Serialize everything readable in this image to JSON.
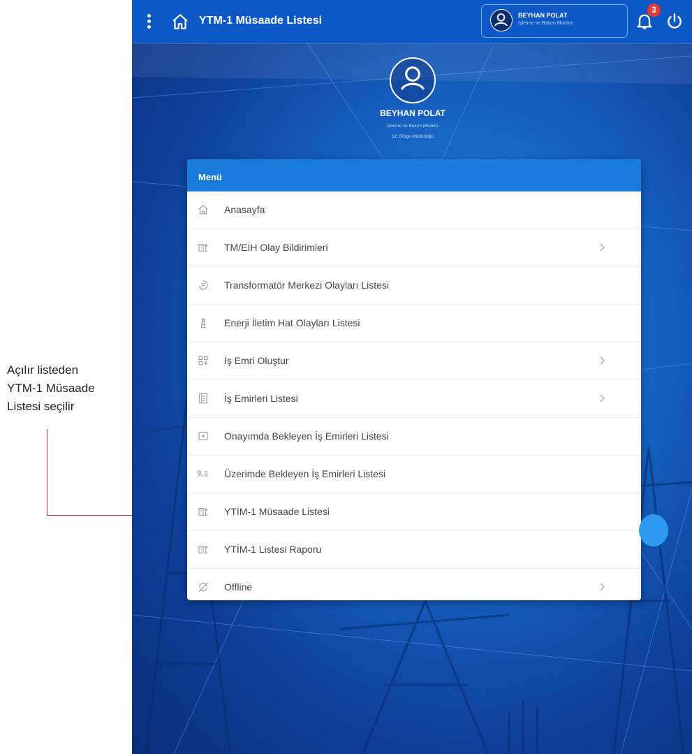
{
  "annotation": {
    "lines": [
      "Açılır listeden",
      "YTM-1 Müsaade",
      "Listesi  seçilir"
    ]
  },
  "header": {
    "title": "YTM-1 Müsaade Listesi",
    "user_name": "BEYHAN POLAT",
    "user_role": "İşletme ve Bakım Müdürü",
    "notification_count": "3"
  },
  "profile": {
    "name": "BEYHAN POLAT",
    "role": "İşletme ve Bakım Müdürü",
    "department": "12. Bölge Müdürlüğü"
  },
  "menu": {
    "title": "Menü",
    "items": [
      {
        "label": "Anasayfa",
        "icon": "home-icon",
        "has_submenu": false
      },
      {
        "label": "TM/EİH Olay Bildirimleri",
        "icon": "report-icon",
        "has_submenu": true
      },
      {
        "label": "Transformatör Merkezi Olayları Listesi",
        "icon": "transformer-icon",
        "has_submenu": false
      },
      {
        "label": "Enerji İletim Hat Olayları Listesi",
        "icon": "tower-icon",
        "has_submenu": false
      },
      {
        "label": "İş Emri Oluştur",
        "icon": "grid-plus-icon",
        "has_submenu": true
      },
      {
        "label": "İş Emirleri Listesi",
        "icon": "list-doc-icon",
        "has_submenu": true
      },
      {
        "label": "Onayımda Bekleyen İş Emirleri Listesi",
        "icon": "approval-icon",
        "has_submenu": false
      },
      {
        "label": "Üzerimde Bekleyen İş Emirleri Listesi",
        "icon": "user-list-icon",
        "has_submenu": false
      },
      {
        "label": "YTİM-1 Müsaade Listesi",
        "icon": "report-icon",
        "has_submenu": false
      },
      {
        "label": "YTİM-1 Listesi Raporu",
        "icon": "report-icon",
        "has_submenu": false
      },
      {
        "label": "Offline",
        "icon": "offline-icon",
        "has_submenu": true
      }
    ]
  },
  "colors": {
    "topbar": "#0d58c7",
    "menu_header": "#1a7bdc",
    "badge": "#e53935",
    "annotation_line": "#d32f2f"
  }
}
